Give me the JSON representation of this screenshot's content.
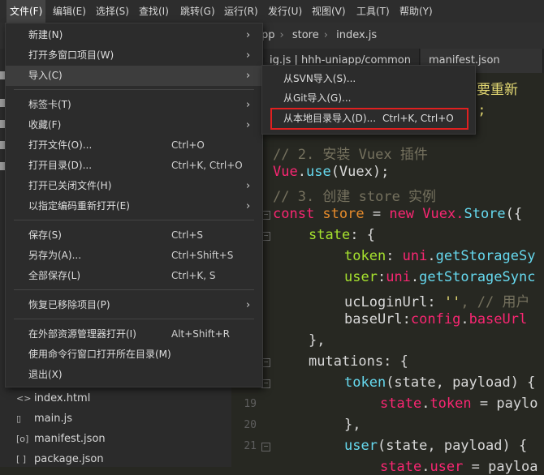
{
  "menubar": {
    "items": [
      "文件(F)",
      "编辑(E)",
      "选择(S)",
      "查找(I)",
      "跳转(G)",
      "运行(R)",
      "发行(U)",
      "视图(V)",
      "工具(T)",
      "帮助(Y)"
    ]
  },
  "breadcrumb": {
    "items": [
      "pp",
      "store",
      "index.js"
    ]
  },
  "tabs": [
    "ig.js | hhh-uniapp/common",
    "manifest.json"
  ],
  "file_menu": {
    "items": [
      {
        "label": "新建(N)",
        "shortcut": "",
        "arrow": "›"
      },
      {
        "label": "打开多窗口项目(W)",
        "shortcut": "",
        "arrow": "›"
      },
      {
        "label": "导入(C)",
        "shortcut": "",
        "arrow": "›"
      },
      {
        "label": "标签卡(T)",
        "shortcut": "",
        "arrow": "›"
      },
      {
        "label": "收藏(F)",
        "shortcut": "",
        "arrow": "›"
      },
      {
        "label": "打开文件(O)...",
        "shortcut": "Ctrl+O",
        "arrow": ""
      },
      {
        "label": "打开目录(D)...",
        "shortcut": "Ctrl+K, Ctrl+O",
        "arrow": ""
      },
      {
        "label": "打开已关闭文件(H)",
        "shortcut": "",
        "arrow": "›"
      },
      {
        "label": "以指定编码重新打开(E)",
        "shortcut": "",
        "arrow": "›"
      },
      {
        "label": "保存(S)",
        "shortcut": "Ctrl+S",
        "arrow": ""
      },
      {
        "label": "另存为(A)...",
        "shortcut": "Ctrl+Shift+S",
        "arrow": ""
      },
      {
        "label": "全部保存(L)",
        "shortcut": "Ctrl+K, S",
        "arrow": ""
      },
      {
        "label": "恢复已移除项目(P)",
        "shortcut": "",
        "arrow": "›"
      },
      {
        "label": "在外部资源管理器打开(I)",
        "shortcut": "Alt+Shift+R",
        "arrow": ""
      },
      {
        "label": "使用命令行窗口打开所在目录(M)",
        "shortcut": "",
        "arrow": ""
      },
      {
        "label": "退出(X)",
        "shortcut": "",
        "arrow": ""
      }
    ]
  },
  "import_submenu": {
    "items": [
      {
        "label": "从SVN导入(S)...",
        "shortcut": ""
      },
      {
        "label": "从Git导入(G)...",
        "shortcut": ""
      },
      {
        "label": "从本地目录导入(D)...",
        "shortcut": "Ctrl+K, Ctrl+O"
      }
    ]
  },
  "files": [
    {
      "icon": "<>",
      "name": "index.html"
    },
    {
      "icon": "▯",
      "name": "main.js"
    },
    {
      "icon": "[o]",
      "name": "manifest.json"
    },
    {
      "icon": "[ ]",
      "name": "package.json"
    }
  ],
  "line_numbers": [
    "19",
    "20",
    "21"
  ],
  "code": {
    "l0a": "需要重新",
    "l0b": "\";",
    "l1": "// 2. 安装 Vuex 插件",
    "l2a": "Vue",
    "l2b": ".",
    "l2c": "use",
    "l2d": "(Vuex);",
    "l3": "// 3. 创建 store 实例",
    "l4a": "const",
    "l4b": " store",
    "l4c": " = ",
    "l4d": "new",
    "l4e": " Vuex.",
    "l4f": "Store",
    "l4g": "({",
    "l5a": "state",
    "l5b": ": {",
    "l6a": "token",
    "l6b": ": ",
    "l6c": "uni",
    "l6d": ".",
    "l6e": "getStorageSy",
    "l7a": "user",
    "l7b": ":",
    "l7c": "uni",
    "l7d": ".",
    "l7e": "getStorageSync",
    "l8a": "ucLoginUrl",
    "l8b": ": ",
    "l8c": "''",
    "l8d": ", // 用户",
    "l9a": "baseUrl",
    "l9b": ":",
    "l9c": "config",
    "l9d": ".",
    "l9e": "baseUrl",
    "l10": "},",
    "l11a": "mutations",
    "l11b": ": {",
    "l12a": "token",
    "l12b": "(state, payload) {",
    "l13a": "state",
    "l13b": ".",
    "l13c": "token",
    "l13d": " = ",
    "l13e": "paylo",
    "l14": "},",
    "l15a": "user",
    "l15b": "(state, payload) {",
    "l16a": "state",
    "l16b": ".",
    "l16c": "user",
    "l16d": " = ",
    "l16e": "payloa"
  }
}
